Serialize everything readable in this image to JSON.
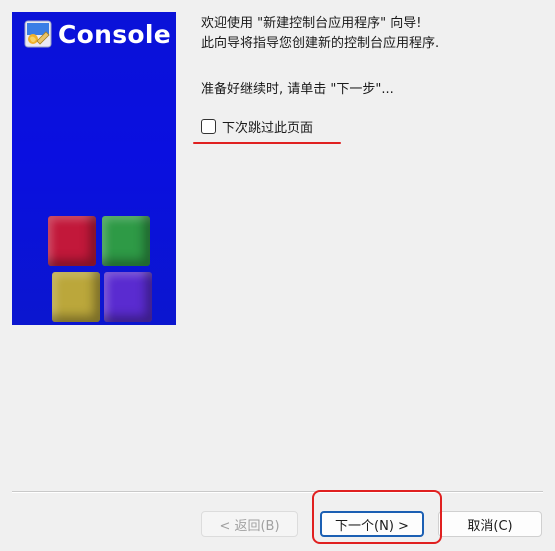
{
  "banner": {
    "title": "Console",
    "logo_icon": "paint-palette-icon",
    "background": "#0a12d8",
    "cubes": [
      {
        "name": "red",
        "color": "#c2183a"
      },
      {
        "name": "green",
        "color": "#2e9a46"
      },
      {
        "name": "yellow",
        "color": "#bba73b"
      },
      {
        "name": "purple",
        "color": "#5a2bd0"
      }
    ]
  },
  "welcome": {
    "line1": "欢迎使用 \"新建控制台应用程序\" 向导!",
    "line2": "此向导将指导您创建新的控制台应用程序.",
    "ready": "准备好继续时, 请单击 \"下一步\"..."
  },
  "skip_checkbox": {
    "label": "下次跳过此页面",
    "checked": false
  },
  "buttons": {
    "back": "< 返回(B)",
    "next": "下一个(N) >",
    "cancel": "取消(C)"
  },
  "colors": {
    "annotation": "#e02020",
    "default_button_border": "#1b5fb3"
  }
}
